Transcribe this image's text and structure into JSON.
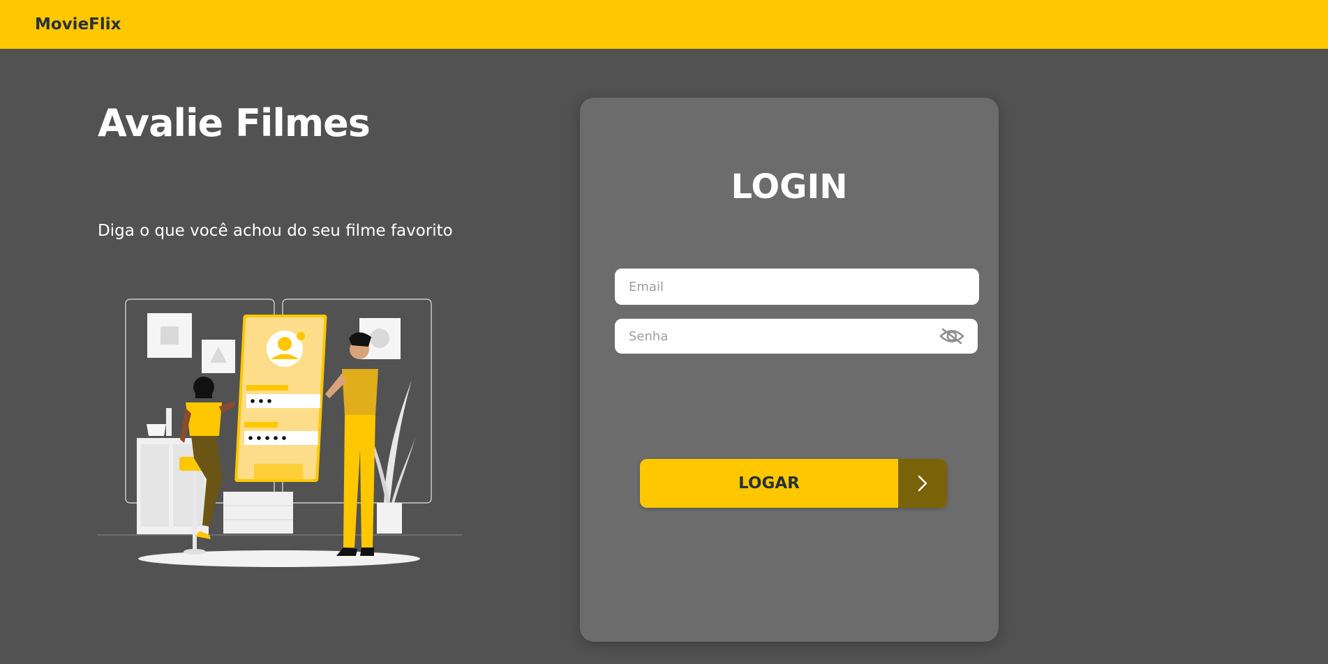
{
  "navbar": {
    "brand": "MovieFlix"
  },
  "hero": {
    "title": "Avalie Filmes",
    "subtitle": "Diga o que você achou do seu filme favorito"
  },
  "login": {
    "title": "LOGIN",
    "email_placeholder": "Email",
    "password_placeholder": "Senha",
    "submit_label": "LOGAR"
  },
  "icons": {
    "password_toggle": "eye-slash-icon",
    "submit_arrow": "chevron-right-icon"
  },
  "colors": {
    "primary": "#FFC700",
    "primary_dark": "#7A6209",
    "background": "#525252",
    "card": "#6C6C6C",
    "text_dark": "#263238",
    "text_light": "#FFFFFF"
  }
}
